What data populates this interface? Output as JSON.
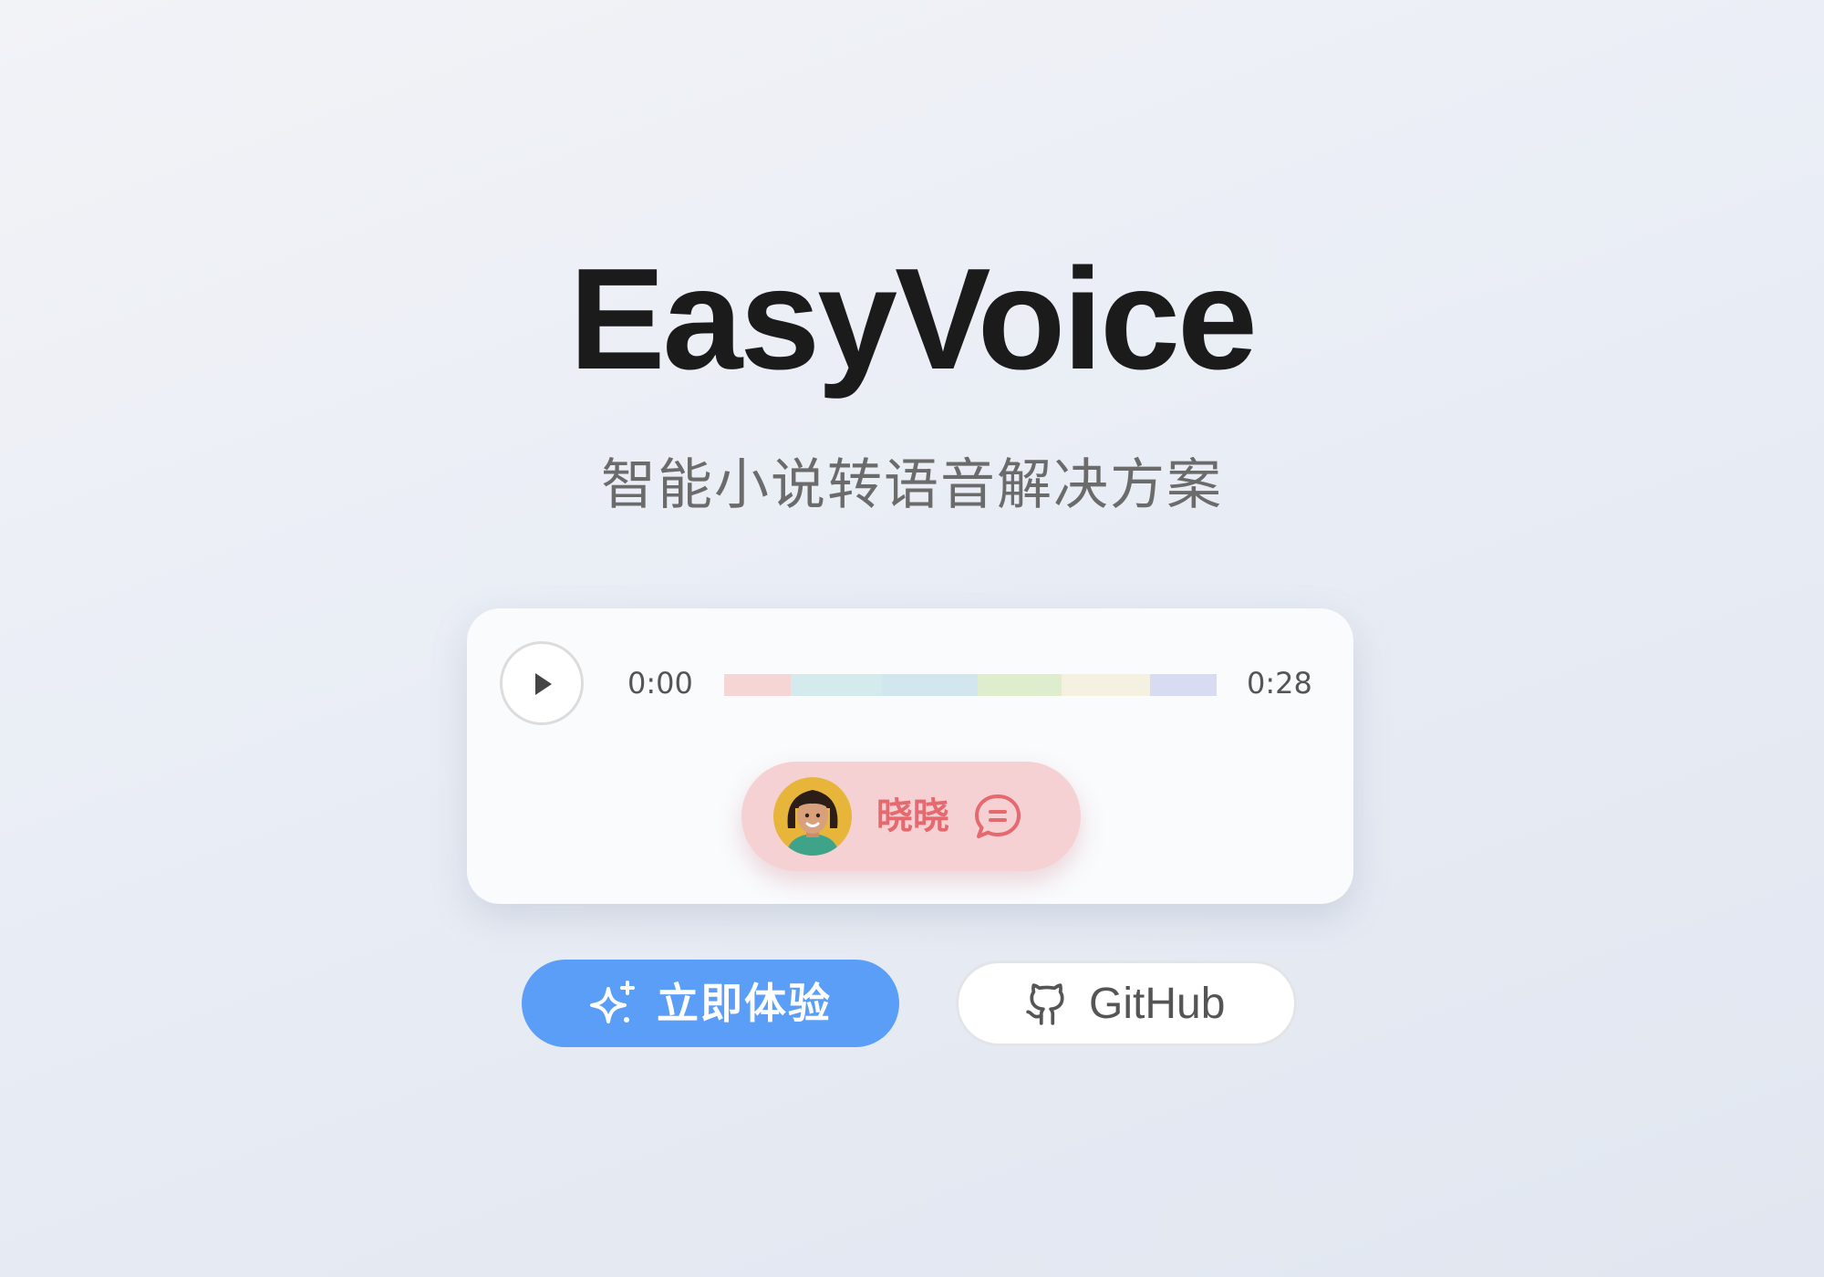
{
  "hero": {
    "title": "EasyVoice",
    "subtitle": "智能小说转语音解决方案"
  },
  "player": {
    "play_icon": "play-icon",
    "current_time": "0:00",
    "total_time": "0:28",
    "progress": 0,
    "segments": [
      {
        "color": "#f6d5d6",
        "share": 0.135
      },
      {
        "color": "#d3ebec",
        "share": 0.185
      },
      {
        "color": "#d2e6ef",
        "share": 0.195
      },
      {
        "color": "#dfedcf",
        "share": 0.17
      },
      {
        "color": "#f5f1e0",
        "share": 0.18
      },
      {
        "color": "#d8dcf3",
        "share": 0.135
      }
    ],
    "speaker": {
      "name": "晓晓",
      "avatar_icon": "girl-avatar-icon",
      "chat_icon": "chat-bubble-icon",
      "accent_color": "#e46a6f",
      "background_color": "#f6d1d3"
    }
  },
  "actions": {
    "try_now": {
      "label": "立即体验",
      "icon": "sparkle-icon",
      "color": "#5a9ef8"
    },
    "github": {
      "label": "GitHub",
      "icon": "github-icon"
    }
  }
}
